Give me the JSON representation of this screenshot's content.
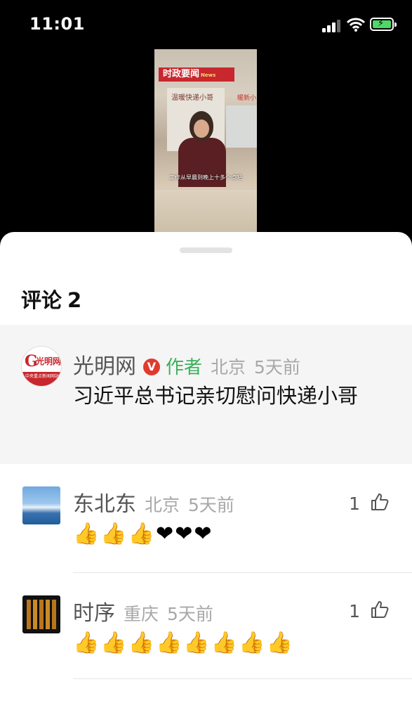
{
  "status_bar": {
    "time": "11:01"
  },
  "video": {
    "banner_title": "时政要闻",
    "banner_tag": "News",
    "wall_text": "温暖快递小哥",
    "side_sign": "暖新小",
    "subtitle": "工作从早晨到晚上十多个点吧"
  },
  "comments_panel": {
    "title_label": "评论",
    "count": "2",
    "pinned": {
      "avatar_brand": "光明网",
      "avatar_sub": "中央重点新闻网站",
      "name": "光明网",
      "verified_badge": "V",
      "author_tag": "作者",
      "location": "北京",
      "time": "5天前",
      "text": "习近平总书记亲切慰问快递小哥"
    },
    "items": [
      {
        "name": "东北东",
        "location": "北京",
        "time": "5天前",
        "like_count": "1",
        "emojis": "👍👍👍❤❤❤"
      },
      {
        "name": "时序",
        "location": "重庆",
        "time": "5天前",
        "like_count": "1",
        "emojis": "👍👍👍👍👍👍👍👍"
      }
    ]
  },
  "colors": {
    "author_green": "#3cb05b",
    "badge_red": "#e03a2f",
    "pinned_bg": "#f5f5f5"
  }
}
